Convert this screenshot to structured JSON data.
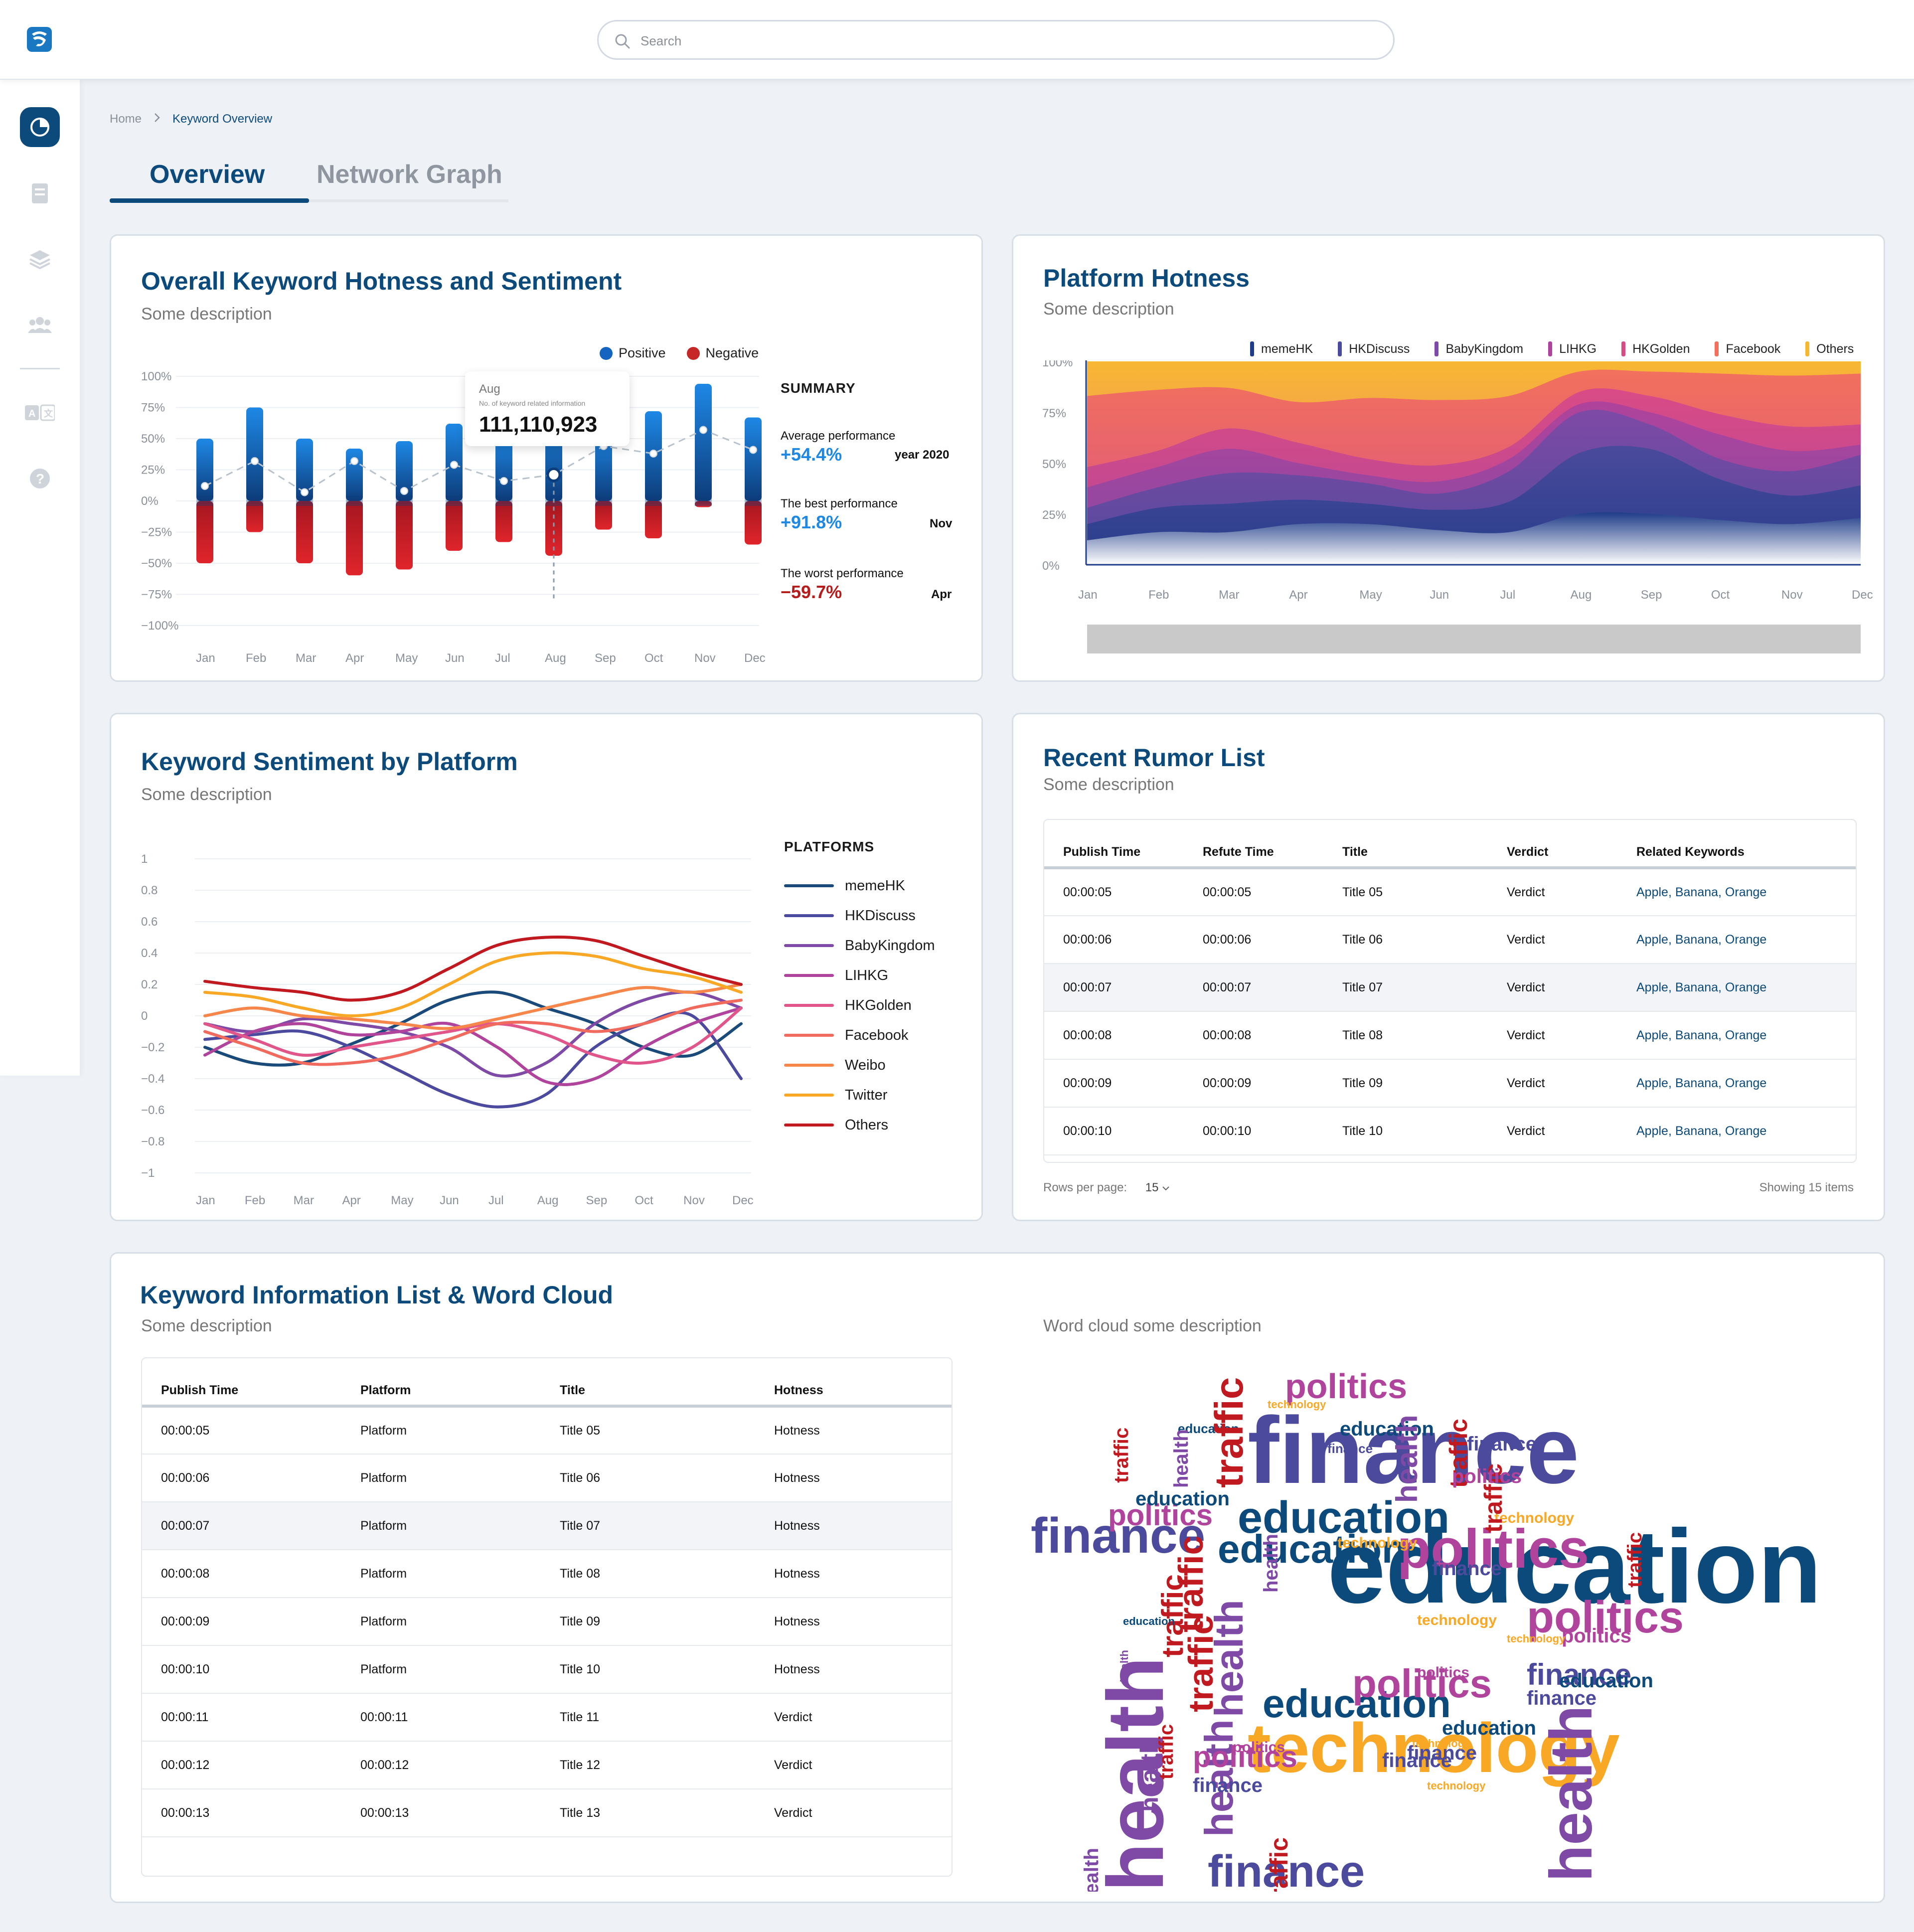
{
  "search": {
    "placeholder": "Search"
  },
  "breadcrumb": {
    "home": "Home",
    "current": "Keyword Overview"
  },
  "tabs": [
    {
      "label": "Overview",
      "active": true
    },
    {
      "label": "Network Graph",
      "active": false
    }
  ],
  "colors": {
    "brand": "#0d4a7c",
    "positive": "#1565c0",
    "negative": "#c62828"
  },
  "hotness_card": {
    "title": "Overall Keyword Hotness and Sentiment",
    "description": "Some description",
    "legend": {
      "positive": "Positive",
      "negative": "Negative"
    },
    "tooltip": {
      "month": "Aug",
      "caption": "No. of keyword related information",
      "value": "111,110,923"
    },
    "summary": {
      "heading": "SUMMARY",
      "average": {
        "label": "Average performance",
        "value": "+54.4%",
        "period": "year 2020"
      },
      "best": {
        "label": "The best performance",
        "value": "+91.8%",
        "period": "Nov"
      },
      "worst": {
        "label": "The worst performance",
        "value": "−59.7%",
        "period": "Apr"
      }
    }
  },
  "platform_card": {
    "title": "Platform Hotness",
    "description": "Some description",
    "legend": [
      {
        "name": "memeHK",
        "color": "#1f3c88"
      },
      {
        "name": "HKDiscuss",
        "color": "#4b4a9c"
      },
      {
        "name": "BabyKingdom",
        "color": "#7e4aa6"
      },
      {
        "name": "LIHKG",
        "color": "#b0439c"
      },
      {
        "name": "HKGolden",
        "color": "#d94b86"
      },
      {
        "name": "Facebook",
        "color": "#f2705d"
      },
      {
        "name": "Others",
        "color": "#f7b733"
      }
    ]
  },
  "sentiment_card": {
    "title": "Keyword Sentiment by Platform",
    "description": "Some description",
    "platforms_heading": "PLATFORMS",
    "platforms": [
      {
        "name": "memeHK",
        "color": "#1a4a7a"
      },
      {
        "name": "HKDiscuss",
        "color": "#4c4a9e"
      },
      {
        "name": "BabyKingdom",
        "color": "#7e4aa6"
      },
      {
        "name": "LIHKG",
        "color": "#b0439c"
      },
      {
        "name": "HKGolden",
        "color": "#e0558a"
      },
      {
        "name": "Facebook",
        "color": "#f06a5e"
      },
      {
        "name": "Weibo",
        "color": "#f7864a"
      },
      {
        "name": "Twitter",
        "color": "#f9a825"
      },
      {
        "name": "Others",
        "color": "#c0191f"
      }
    ]
  },
  "rumor_card": {
    "title": "Recent Rumor List",
    "description": "Some description",
    "columns": [
      "Publish Time",
      "Refute Time",
      "Title",
      "Verdict",
      "Related Keywords"
    ],
    "rows": [
      [
        "00:00:05",
        "00:00:05",
        "Title 05",
        "Verdict",
        "Apple, Banana, Orange"
      ],
      [
        "00:00:06",
        "00:00:06",
        "Title 06",
        "Verdict",
        "Apple, Banana, Orange"
      ],
      [
        "00:00:07",
        "00:00:07",
        "Title 07",
        "Verdict",
        "Apple, Banana, Orange"
      ],
      [
        "00:00:08",
        "00:00:08",
        "Title 08",
        "Verdict",
        "Apple, Banana, Orange"
      ],
      [
        "00:00:09",
        "00:00:09",
        "Title 09",
        "Verdict",
        "Apple, Banana, Orange"
      ],
      [
        "00:00:10",
        "00:00:10",
        "Title 10",
        "Verdict",
        "Apple, Banana, Orange"
      ]
    ],
    "rows_per_page_label": "Rows per page:",
    "rows_per_page": "15",
    "showing": "Showing 15 items"
  },
  "keyword_card": {
    "title": "Keyword Information List & Word Cloud",
    "description": "Some description",
    "columns": [
      "Publish Time",
      "Platform",
      "Title",
      "Hotness"
    ],
    "rows": [
      [
        "00:00:05",
        "Platform",
        "Title 05",
        "Hotness"
      ],
      [
        "00:00:06",
        "Platform",
        "Title 06",
        "Hotness"
      ],
      [
        "00:00:07",
        "Platform",
        "Title 07",
        "Hotness"
      ],
      [
        "00:00:08",
        "Platform",
        "Title 08",
        "Hotness"
      ],
      [
        "00:00:09",
        "Platform",
        "Title 09",
        "Hotness"
      ],
      [
        "00:00:10",
        "Platform",
        "Title 10",
        "Hotness"
      ],
      [
        "00:00:11",
        "00:00:11",
        "Title 11",
        "Verdict"
      ],
      [
        "00:00:12",
        "00:00:12",
        "Title 12",
        "Verdict"
      ],
      [
        "00:00:13",
        "00:00:13",
        "Title 13",
        "Verdict"
      ]
    ],
    "wordcloud_description": "Word cloud some description",
    "words": [
      "education",
      "finance",
      "technology",
      "politics",
      "health",
      "traffic"
    ]
  },
  "chart_data": [
    {
      "type": "bar",
      "categories": [
        "Jan",
        "Feb",
        "Mar",
        "Apr",
        "May",
        "Jun",
        "Jul",
        "Aug",
        "Sep",
        "Oct",
        "Nov",
        "Dec"
      ],
      "series": [
        {
          "name": "Positive",
          "values": [
            50,
            75,
            50,
            42,
            48,
            62,
            53,
            70,
            56,
            72,
            94,
            67
          ]
        },
        {
          "name": "Negative",
          "values": [
            -50,
            -25,
            -50,
            -59.7,
            -55,
            -40,
            -33,
            -44,
            -23,
            -30,
            -5,
            -35
          ]
        },
        {
          "name": "",
          "type": "line",
          "values": [
            12,
            32,
            7,
            32,
            8,
            29,
            16,
            21,
            44,
            38,
            57,
            41
          ]
        }
      ],
      "ylim": [
        -100,
        100
      ],
      "yticks": [
        "100%",
        "75%",
        "50%",
        "25%",
        "0%",
        "−25%",
        "−50%",
        "−75%",
        "−100%"
      ]
    },
    {
      "type": "area",
      "categories": [
        "Jan",
        "Feb",
        "Mar",
        "Apr",
        "May",
        "Jun",
        "Jul",
        "Aug",
        "Sep",
        "Oct",
        "Nov",
        "Dec"
      ],
      "series": [
        {
          "name": "memeHK",
          "values": [
            12,
            16,
            16,
            20,
            20,
            17,
            16,
            25,
            25,
            22,
            20,
            23
          ]
        },
        {
          "name": "HKDiscuss",
          "values": [
            8,
            12,
            14,
            12,
            10,
            10,
            15,
            30,
            32,
            20,
            14,
            16
          ]
        },
        {
          "name": "BabyKingdom",
          "values": [
            8,
            10,
            15,
            12,
            10,
            8,
            15,
            20,
            12,
            10,
            12,
            15
          ]
        },
        {
          "name": "LIHKG",
          "values": [
            10,
            10,
            12,
            6,
            4,
            6,
            6,
            4,
            6,
            12,
            10,
            5
          ]
        },
        {
          "name": "HKGolden",
          "values": [
            10,
            8,
            10,
            10,
            8,
            8,
            6,
            6,
            8,
            10,
            12,
            10
          ]
        },
        {
          "name": "Facebook",
          "values": [
            35,
            30,
            20,
            20,
            30,
            32,
            25,
            10,
            12,
            20,
            25,
            25
          ]
        },
        {
          "name": "Others",
          "values": [
            17,
            14,
            13,
            20,
            18,
            19,
            17,
            5,
            5,
            6,
            7,
            6
          ]
        }
      ],
      "ylim": [
        0,
        100
      ],
      "yticks": [
        "100%",
        "75%",
        "50%",
        "25%",
        "0%"
      ]
    },
    {
      "type": "line",
      "categories": [
        "Jan",
        "Feb",
        "Mar",
        "Apr",
        "May",
        "Jun",
        "Jul",
        "Aug",
        "Sep",
        "Oct",
        "Nov",
        "Dec"
      ],
      "series": [
        {
          "name": "memeHK",
          "values": [
            -0.2,
            -0.3,
            -0.3,
            -0.18,
            -0.05,
            0.1,
            0.15,
            0.05,
            -0.05,
            -0.2,
            -0.25,
            -0.05
          ]
        },
        {
          "name": "HKDiscuss",
          "values": [
            -0.15,
            -0.12,
            -0.1,
            -0.2,
            -0.35,
            -0.5,
            -0.58,
            -0.5,
            -0.2,
            -0.05,
            0.0,
            -0.4
          ]
        },
        {
          "name": "BabyKingdom",
          "values": [
            -0.05,
            -0.1,
            -0.02,
            -0.05,
            -0.1,
            -0.2,
            -0.38,
            -0.3,
            -0.05,
            0.1,
            0.15,
            0.05
          ]
        },
        {
          "name": "LIHKG",
          "values": [
            -0.25,
            -0.1,
            -0.05,
            -0.12,
            -0.1,
            -0.05,
            -0.2,
            -0.42,
            -0.4,
            -0.2,
            -0.05,
            0.05
          ]
        },
        {
          "name": "HKGolden",
          "values": [
            -0.05,
            -0.15,
            -0.25,
            -0.2,
            -0.15,
            -0.1,
            -0.05,
            -0.12,
            -0.25,
            -0.3,
            -0.2,
            0.05
          ]
        },
        {
          "name": "Facebook",
          "values": [
            -0.1,
            -0.2,
            -0.3,
            -0.3,
            -0.25,
            -0.15,
            -0.05,
            -0.05,
            -0.1,
            -0.05,
            0.05,
            0.1
          ]
        },
        {
          "name": "Weibo",
          "values": [
            0.0,
            0.05,
            0.0,
            -0.02,
            -0.05,
            -0.08,
            -0.02,
            0.05,
            0.12,
            0.18,
            0.15,
            0.2
          ]
        },
        {
          "name": "Twitter",
          "values": [
            0.15,
            0.12,
            0.05,
            0.0,
            0.05,
            0.2,
            0.35,
            0.4,
            0.38,
            0.3,
            0.25,
            0.15
          ]
        },
        {
          "name": "Others",
          "values": [
            0.22,
            0.18,
            0.15,
            0.1,
            0.15,
            0.3,
            0.45,
            0.5,
            0.48,
            0.38,
            0.28,
            0.2
          ]
        }
      ],
      "ylim": [
        -1,
        1
      ],
      "yticks": [
        "1",
        "0.8",
        "0.6",
        "0.4",
        "0.2",
        "0",
        "−0.2",
        "−0.4",
        "−0.6",
        "−0.8",
        "−1"
      ]
    }
  ]
}
